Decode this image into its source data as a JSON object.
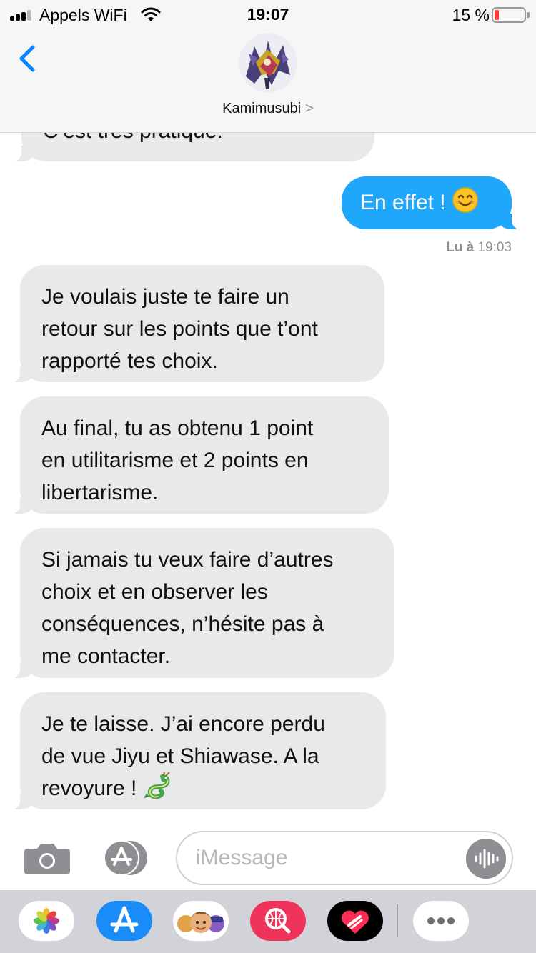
{
  "status_bar": {
    "carrier": "Appels WiFi",
    "time": "19:07",
    "battery_percent_text": "15 %",
    "battery_level": 0.15,
    "signal_bars_active": 3,
    "signal_bars_total": 4
  },
  "header": {
    "contact_name": "Kamimusubi",
    "chevron": ">"
  },
  "messages": [
    {
      "direction": "incoming",
      "text": "C’est très pratique."
    },
    {
      "direction": "outgoing",
      "text": "En effet !",
      "emoji": "smiling-face-icon"
    },
    {
      "direction": "incoming",
      "lines": [
        "Je voulais juste te faire un",
        "retour sur les points que t’ont",
        "rapporté tes choix."
      ]
    },
    {
      "direction": "incoming",
      "lines": [
        "Au final, tu as obtenu 1 point",
        "en utilitarisme et 2 points en",
        "libertarisme."
      ]
    },
    {
      "direction": "incoming",
      "lines": [
        "Si jamais tu veux faire d’autres",
        "choix et en observer les",
        "conséquences, n’hésite pas à",
        "me contacter."
      ]
    },
    {
      "direction": "incoming",
      "lines": [
        "Je te laisse. J’ai encore perdu",
        "de vue Jiyu et Shiawase. A la",
        "revoyure !"
      ],
      "emoji": "dragon-icon"
    }
  ],
  "read_receipt": {
    "label": "Lu à",
    "time": "19:03"
  },
  "input_bar": {
    "placeholder": "iMessage"
  },
  "app_drawer": [
    "photos-icon",
    "app-store-icon",
    "memoji-icon",
    "image-search-icon",
    "digital-touch-icon",
    "more-icon"
  ],
  "colors": {
    "outgoing_bubble": "#1ea7fb",
    "incoming_bubble": "#e9e9eb",
    "accent": "#0a84ff",
    "battery_low": "#ff3b30"
  }
}
